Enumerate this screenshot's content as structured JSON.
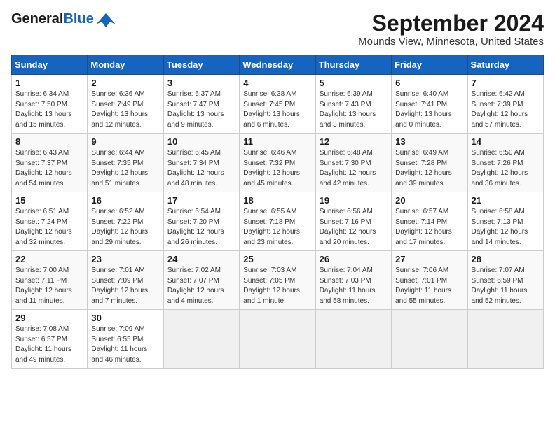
{
  "header": {
    "logo_general": "General",
    "logo_blue": "Blue",
    "title": "September 2024",
    "subtitle": "Mounds View, Minnesota, United States"
  },
  "weekdays": [
    "Sunday",
    "Monday",
    "Tuesday",
    "Wednesday",
    "Thursday",
    "Friday",
    "Saturday"
  ],
  "weeks": [
    [
      {
        "day": "1",
        "detail": "Sunrise: 6:34 AM\nSunset: 7:50 PM\nDaylight: 13 hours\nand 15 minutes."
      },
      {
        "day": "2",
        "detail": "Sunrise: 6:36 AM\nSunset: 7:49 PM\nDaylight: 13 hours\nand 12 minutes."
      },
      {
        "day": "3",
        "detail": "Sunrise: 6:37 AM\nSunset: 7:47 PM\nDaylight: 13 hours\nand 9 minutes."
      },
      {
        "day": "4",
        "detail": "Sunrise: 6:38 AM\nSunset: 7:45 PM\nDaylight: 13 hours\nand 6 minutes."
      },
      {
        "day": "5",
        "detail": "Sunrise: 6:39 AM\nSunset: 7:43 PM\nDaylight: 13 hours\nand 3 minutes."
      },
      {
        "day": "6",
        "detail": "Sunrise: 6:40 AM\nSunset: 7:41 PM\nDaylight: 13 hours\nand 0 minutes."
      },
      {
        "day": "7",
        "detail": "Sunrise: 6:42 AM\nSunset: 7:39 PM\nDaylight: 12 hours\nand 57 minutes."
      }
    ],
    [
      {
        "day": "8",
        "detail": "Sunrise: 6:43 AM\nSunset: 7:37 PM\nDaylight: 12 hours\nand 54 minutes."
      },
      {
        "day": "9",
        "detail": "Sunrise: 6:44 AM\nSunset: 7:35 PM\nDaylight: 12 hours\nand 51 minutes."
      },
      {
        "day": "10",
        "detail": "Sunrise: 6:45 AM\nSunset: 7:34 PM\nDaylight: 12 hours\nand 48 minutes."
      },
      {
        "day": "11",
        "detail": "Sunrise: 6:46 AM\nSunset: 7:32 PM\nDaylight: 12 hours\nand 45 minutes."
      },
      {
        "day": "12",
        "detail": "Sunrise: 6:48 AM\nSunset: 7:30 PM\nDaylight: 12 hours\nand 42 minutes."
      },
      {
        "day": "13",
        "detail": "Sunrise: 6:49 AM\nSunset: 7:28 PM\nDaylight: 12 hours\nand 39 minutes."
      },
      {
        "day": "14",
        "detail": "Sunrise: 6:50 AM\nSunset: 7:26 PM\nDaylight: 12 hours\nand 36 minutes."
      }
    ],
    [
      {
        "day": "15",
        "detail": "Sunrise: 6:51 AM\nSunset: 7:24 PM\nDaylight: 12 hours\nand 32 minutes."
      },
      {
        "day": "16",
        "detail": "Sunrise: 6:52 AM\nSunset: 7:22 PM\nDaylight: 12 hours\nand 29 minutes."
      },
      {
        "day": "17",
        "detail": "Sunrise: 6:54 AM\nSunset: 7:20 PM\nDaylight: 12 hours\nand 26 minutes."
      },
      {
        "day": "18",
        "detail": "Sunrise: 6:55 AM\nSunset: 7:18 PM\nDaylight: 12 hours\nand 23 minutes."
      },
      {
        "day": "19",
        "detail": "Sunrise: 6:56 AM\nSunset: 7:16 PM\nDaylight: 12 hours\nand 20 minutes."
      },
      {
        "day": "20",
        "detail": "Sunrise: 6:57 AM\nSunset: 7:14 PM\nDaylight: 12 hours\nand 17 minutes."
      },
      {
        "day": "21",
        "detail": "Sunrise: 6:58 AM\nSunset: 7:13 PM\nDaylight: 12 hours\nand 14 minutes."
      }
    ],
    [
      {
        "day": "22",
        "detail": "Sunrise: 7:00 AM\nSunset: 7:11 PM\nDaylight: 12 hours\nand 11 minutes."
      },
      {
        "day": "23",
        "detail": "Sunrise: 7:01 AM\nSunset: 7:09 PM\nDaylight: 12 hours\nand 7 minutes."
      },
      {
        "day": "24",
        "detail": "Sunrise: 7:02 AM\nSunset: 7:07 PM\nDaylight: 12 hours\nand 4 minutes."
      },
      {
        "day": "25",
        "detail": "Sunrise: 7:03 AM\nSunset: 7:05 PM\nDaylight: 12 hours\nand 1 minute."
      },
      {
        "day": "26",
        "detail": "Sunrise: 7:04 AM\nSunset: 7:03 PM\nDaylight: 11 hours\nand 58 minutes."
      },
      {
        "day": "27",
        "detail": "Sunrise: 7:06 AM\nSunset: 7:01 PM\nDaylight: 11 hours\nand 55 minutes."
      },
      {
        "day": "28",
        "detail": "Sunrise: 7:07 AM\nSunset: 6:59 PM\nDaylight: 11 hours\nand 52 minutes."
      }
    ],
    [
      {
        "day": "29",
        "detail": "Sunrise: 7:08 AM\nSunset: 6:57 PM\nDaylight: 11 hours\nand 49 minutes."
      },
      {
        "day": "30",
        "detail": "Sunrise: 7:09 AM\nSunset: 6:55 PM\nDaylight: 11 hours\nand 46 minutes."
      },
      {
        "day": "",
        "detail": ""
      },
      {
        "day": "",
        "detail": ""
      },
      {
        "day": "",
        "detail": ""
      },
      {
        "day": "",
        "detail": ""
      },
      {
        "day": "",
        "detail": ""
      }
    ]
  ]
}
